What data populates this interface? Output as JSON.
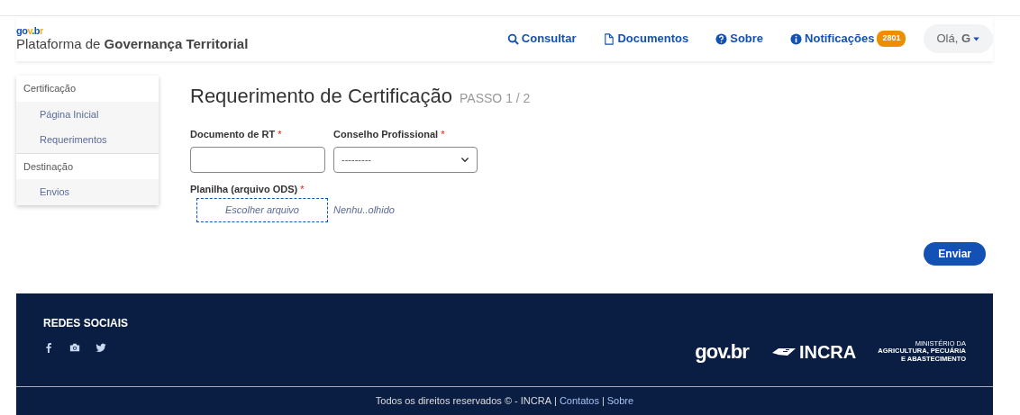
{
  "header": {
    "logo": "gov.br",
    "site_title": "Plataforma de **Governança Territorial**",
    "nav": [
      {
        "kind": "search",
        "label": "Consultar"
      },
      {
        "kind": "document",
        "label": "Documentos"
      },
      {
        "kind": "question",
        "label": "Sobre"
      },
      {
        "kind": "info",
        "label": "Notificações",
        "badge": "2801"
      }
    ],
    "user_menu": "Olá, **G**"
  },
  "sidebar": {
    "sections": [
      {
        "title": "Certificação",
        "items": [
          "Página Inicial",
          "Requerimentos"
        ]
      },
      {
        "title": "Destinação",
        "items": [
          "Envios"
        ]
      }
    ]
  },
  "form": {
    "title": "Requerimento de Certificação",
    "step": "PASSO 1 / 2",
    "fields": [
      {
        "kind": "text",
        "label": "Documento de RT",
        "required_mark": "*"
      },
      {
        "kind": "select",
        "label": "Conselho Profissional",
        "required_mark": "*",
        "value": "---------"
      }
    ],
    "file_field": {
      "label": "Planilha (arquivo ODS)",
      "required_mark": "*",
      "button": "Escolher arquivo",
      "status": "Nenhu..olhido"
    },
    "submit": "Enviar"
  },
  "footer": {
    "social_title": "REDES SOCIAIS",
    "social": [
      {
        "kind": "facebook"
      },
      {
        "kind": "camera"
      },
      {
        "kind": "twitter"
      }
    ],
    "logos": {
      "govbr": "gov.br",
      "incra": "INCRA",
      "ministry": [
        "MINISTÉRIO DA",
        "AGRICULTURA, PECUÁRIA",
        "E ABASTECIMENTO"
      ]
    },
    "bottom_line": [
      {
        "kind": "text",
        "text": "Todos os direitos reservados © - INCRA"
      },
      {
        "kind": "separator",
        "text": "|"
      },
      {
        "kind": "link",
        "text": "Contatos"
      },
      {
        "kind": "separator",
        "text": "|"
      },
      {
        "kind": "link",
        "text": "Sobre"
      }
    ]
  }
}
